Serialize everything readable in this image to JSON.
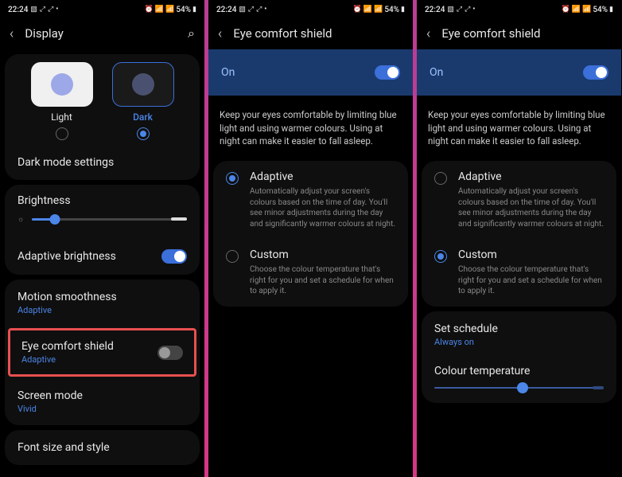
{
  "status": {
    "time": "22:24",
    "battery": "54%"
  },
  "screen1": {
    "title": "Display",
    "theme": {
      "light_label": "Light",
      "dark_label": "Dark"
    },
    "dark_mode_settings": "Dark mode settings",
    "brightness": "Brightness",
    "adaptive_brightness": "Adaptive brightness",
    "motion_smoothness": {
      "title": "Motion smoothness",
      "sub": "Adaptive"
    },
    "eye_comfort": {
      "title": "Eye comfort shield",
      "sub": "Adaptive"
    },
    "screen_mode": {
      "title": "Screen mode",
      "sub": "Vivid"
    },
    "font": "Font size and style"
  },
  "screen2": {
    "title": "Eye comfort shield",
    "on": "On",
    "info": "Keep your eyes comfortable by limiting blue light and using warmer colours. Using at night can make it easier to fall asleep.",
    "adaptive": {
      "title": "Adaptive",
      "desc": "Automatically adjust your screen's colours based on the time of day. You'll see minor adjustments during the day and significantly warmer colours at night."
    },
    "custom": {
      "title": "Custom",
      "desc": "Choose the colour temperature that's right for you and set a schedule for when to apply it."
    }
  },
  "screen3": {
    "title": "Eye comfort shield",
    "on": "On",
    "info": "Keep your eyes comfortable by limiting blue light and using warmer colours. Using at night can make it easier to fall asleep.",
    "adaptive": {
      "title": "Adaptive",
      "desc": "Automatically adjust your screen's colours based on the time of day. You'll see minor adjustments during the day and significantly warmer colours at night."
    },
    "custom": {
      "title": "Custom",
      "desc": "Choose the colour temperature that's right for you and set a schedule for when to apply it."
    },
    "schedule": {
      "title": "Set schedule",
      "sub": "Always on"
    },
    "temp": "Colour temperature"
  }
}
